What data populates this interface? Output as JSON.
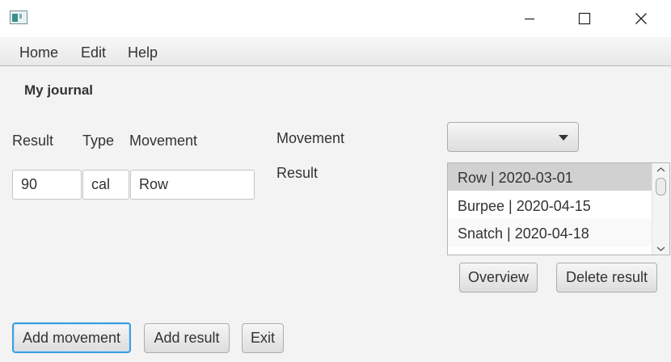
{
  "window": {
    "icon": "app-window-icon",
    "controls": [
      "minimize-icon",
      "maximize-icon",
      "close-icon"
    ]
  },
  "menu": {
    "items": [
      "Home",
      "Edit",
      "Help"
    ]
  },
  "page_title": "My journal",
  "entry": {
    "headers": {
      "result": "Result",
      "type": "Type",
      "movement": "Movement"
    },
    "result_value": "90",
    "type_value": "cal",
    "movement_value": "Row"
  },
  "filter": {
    "movement_label": "Movement",
    "result_label": "Result",
    "combo_value": ""
  },
  "results_list": [
    "Row | 2020-03-01",
    "Burpee | 2020-04-15",
    "Snatch | 2020-04-18"
  ],
  "buttons": {
    "overview": "Overview",
    "delete_result": "Delete result",
    "add_movement": "Add movement",
    "add_result": "Add result",
    "exit": "Exit"
  },
  "colors": {
    "focus_border": "#3d9de0",
    "selected_row": "#d1d1d1",
    "background": "#f3f3f3"
  }
}
